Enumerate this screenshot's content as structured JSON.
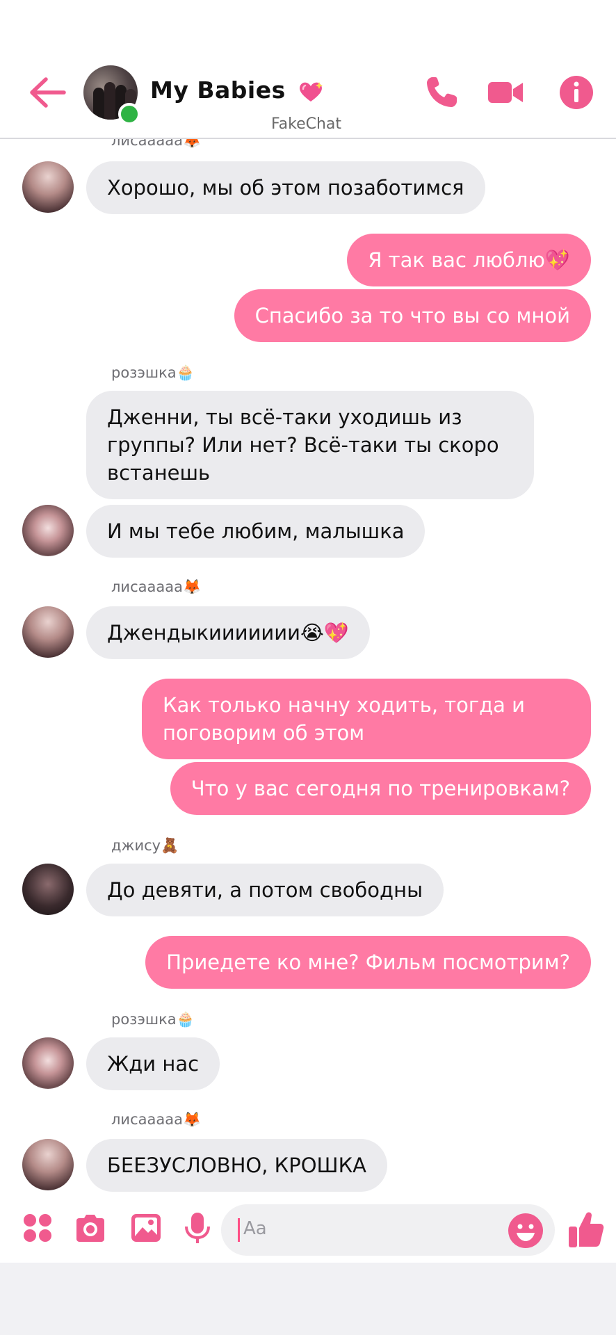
{
  "colors": {
    "accent": "#ff7aa4",
    "incoming_bubble": "#ebebee",
    "online": "#2fb344",
    "header_icon": "#f05a8e"
  },
  "header": {
    "back_icon": "arrow-left-icon",
    "title": "My Babies",
    "watermark": "FakeChat",
    "icons": [
      "phone-icon",
      "video-camera-icon",
      "info-icon"
    ]
  },
  "messages": [
    {
      "sender": "лисааааа🦊"
    },
    {
      "text": "Хорошо, мы об этом позаботимся"
    },
    {
      "text": "Я так вас люблю💖"
    },
    {
      "text": "Спасибо за то что вы со мной"
    },
    {
      "sender": "розэшка🧁"
    },
    {
      "text": "Дженни, ты всё-таки уходишь из группы? Или нет? Всё-таки ты скоро встанешь"
    },
    {
      "text": "И мы тебе любим, малышка"
    },
    {
      "sender": "лисааааа🦊"
    },
    {
      "text": "Джендыкиииииии😭💖"
    },
    {
      "text": "Как только начну ходить, тогда и поговорим об этом"
    },
    {
      "text": "Что у вас сегодня по тренировкам?"
    },
    {
      "sender": "джису🧸"
    },
    {
      "text": "До девяти, а потом свободны"
    },
    {
      "text": "Приедете ко мне? Фильм посмотрим?"
    },
    {
      "sender": "розэшка🧁"
    },
    {
      "text": "Жди нас"
    },
    {
      "sender": "лисааааа🦊"
    },
    {
      "text": "БЕЕЗУСЛОВНО, КРОШКА"
    }
  ],
  "composer": {
    "placeholder": "Aa",
    "icons": [
      "apps-icon",
      "camera-icon",
      "image-icon",
      "microphone-icon",
      "emoji-icon",
      "thumbs-up-icon"
    ]
  }
}
